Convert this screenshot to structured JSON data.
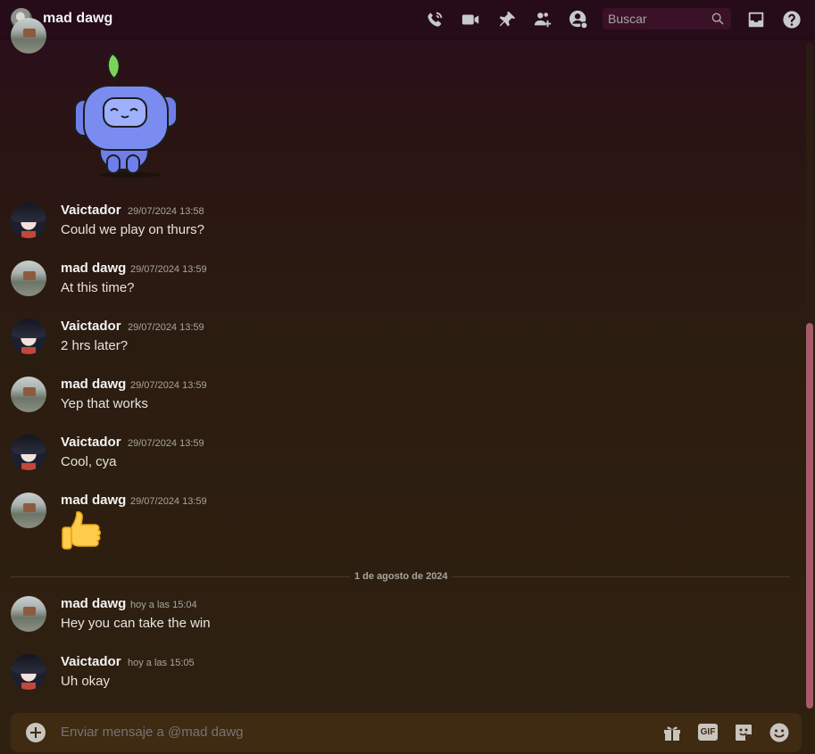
{
  "header": {
    "title": "mad dawg",
    "search_placeholder": "Buscar",
    "icons": [
      "phone-call-icon",
      "video-call-icon",
      "pin-icon",
      "add-friends-icon",
      "user-profile-icon",
      "search-icon",
      "inbox-icon",
      "help-icon"
    ]
  },
  "messages": [
    {
      "author": "Vaictador",
      "time": "29/07/2024 13:58",
      "text": "Could we play on thurs?"
    },
    {
      "author": "mad dawg",
      "time": "29/07/2024 13:59",
      "text": "At this time?"
    },
    {
      "author": "Vaictador",
      "time": "29/07/2024 13:59",
      "text": "2 hrs later?"
    },
    {
      "author": "mad dawg",
      "time": "29/07/2024 13:59",
      "text": "Yep that works"
    },
    {
      "author": "Vaictador",
      "time": "29/07/2024 13:59",
      "text": "Cool, cya"
    },
    {
      "author": "mad dawg",
      "time": "29/07/2024 13:59",
      "text": ""
    },
    {
      "author": "mad dawg",
      "time": "hoy a las 15:04",
      "text": "Hey you can take the win"
    },
    {
      "author": "Vaictador",
      "time": "hoy a las 15:05",
      "text": "Uh okay"
    }
  ],
  "date_divider": "1 de agosto de 2024",
  "composer": {
    "placeholder": "Enviar mensaje a @mad dawg",
    "gif_label": "GIF"
  },
  "colors": {
    "accent": "#a85a6a",
    "header_bg": "#260b19",
    "composer_bg": "#3f2a12"
  }
}
